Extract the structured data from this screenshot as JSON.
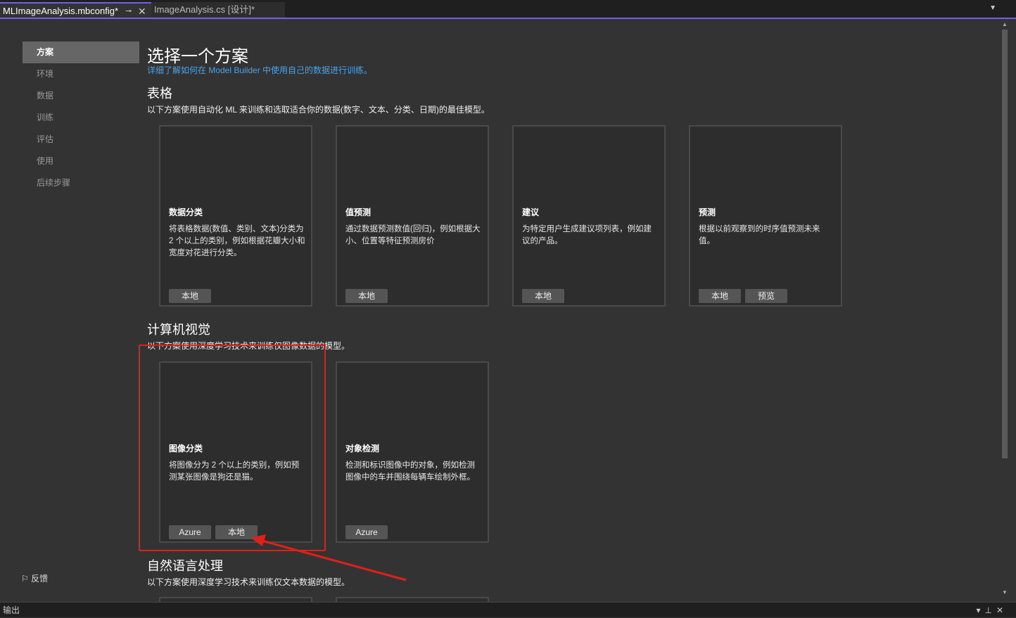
{
  "tabs": [
    {
      "label": "MLImageAnalysis.mbconfig*",
      "active": true
    },
    {
      "label": "ImageAnalysis.cs [设计]*",
      "active": false
    }
  ],
  "sidebar": {
    "items": [
      {
        "label": "方案",
        "selected": true
      },
      {
        "label": "环境"
      },
      {
        "label": "数据"
      },
      {
        "label": "训练"
      },
      {
        "label": "评估"
      },
      {
        "label": "使用"
      },
      {
        "label": "后续步骤"
      }
    ],
    "feedback": "反馈"
  },
  "main": {
    "title": "选择一个方案",
    "link": "详细了解如何在 Model Builder 中使用自己的数据进行训练。",
    "sections": [
      {
        "title": "表格",
        "desc": "以下方案使用自动化 ML 来训练和选取适合你的数据(数字、文本、分类、日期)的最佳模型。",
        "cards": [
          {
            "title": "数据分类",
            "desc": "将表格数据(数值、类别、文本)分类为 2 个以上的类别，例如根据花瓣大小和宽度对花进行分类。",
            "buttons": [
              "本地"
            ]
          },
          {
            "title": "值预测",
            "desc": "通过数据预测数值(回归)，例如根据大小、位置等特征预测房价",
            "buttons": [
              "本地"
            ]
          },
          {
            "title": "建议",
            "desc": "为特定用户生成建议项列表，例如建议的产品。",
            "buttons": [
              "本地"
            ]
          },
          {
            "title": "预测",
            "desc": "根据以前观察到的时序值预测未来值。",
            "buttons": [
              "本地",
              "预览"
            ]
          }
        ]
      },
      {
        "title": "计算机视觉",
        "desc": "以下方案使用深度学习技术来训练仅图像数据的模型。",
        "cards": [
          {
            "title": "图像分类",
            "desc": "将图像分为 2 个以上的类别，例如预测某张图像是狗还是猫。",
            "buttons": [
              "Azure",
              "本地"
            ]
          },
          {
            "title": "对象检测",
            "desc": "检测和标识图像中的对象，例如检测图像中的车并围绕每辆车绘制外框。",
            "buttons": [
              "Azure"
            ]
          }
        ]
      },
      {
        "title": "自然语言处理",
        "desc": "以下方案使用深度学习技术来训练仅文本数据的模型。"
      }
    ]
  },
  "output_panel": {
    "title": "输出"
  },
  "colors": {
    "accent": "#7160e8",
    "annotation": "#e0201a",
    "link": "#4aa3e8"
  }
}
